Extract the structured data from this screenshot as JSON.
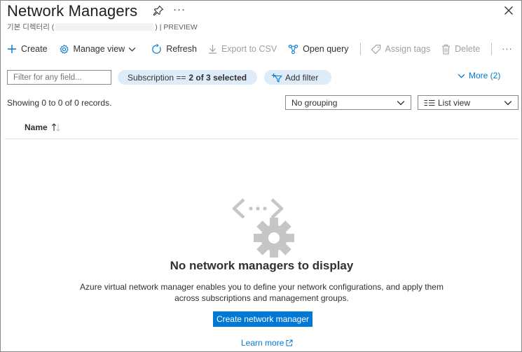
{
  "header": {
    "title": "Network Managers",
    "subtitle_prefix": "기본 디렉터리 (",
    "subtitle_suffix": ") | PREVIEW",
    "more_label": "···"
  },
  "toolbar": {
    "create_label": "Create",
    "manage_view_label": "Manage view",
    "refresh_label": "Refresh",
    "export_label": "Export to CSV",
    "open_query_label": "Open query",
    "assign_tags_label": "Assign tags",
    "delete_label": "Delete",
    "overflow_label": "···"
  },
  "filters": {
    "search_placeholder": "Filter for any field...",
    "subscription_label": "Subscription ==",
    "subscription_value": "2 of 3 selected",
    "add_filter_label": "Add filter",
    "more_label": "More (2)"
  },
  "records": {
    "summary": "Showing 0 to 0 of 0 records.",
    "grouping_value": "No grouping",
    "view_value": "List view"
  },
  "table": {
    "columns": [
      {
        "label": "Name",
        "sort": "ascending"
      }
    ],
    "rows": []
  },
  "empty_state": {
    "title": "No network managers to display",
    "description": "Azure virtual network manager enables you to define your network configurations, and apply them across subscriptions and management groups.",
    "button_label": "Create network manager",
    "learn_more_label": "Learn more"
  },
  "colors": {
    "accent": "#0078d4",
    "pill_bg": "#deecf9",
    "text": "#323130",
    "disabled": "#a19f9d",
    "illustration": "#c8c6c4"
  }
}
